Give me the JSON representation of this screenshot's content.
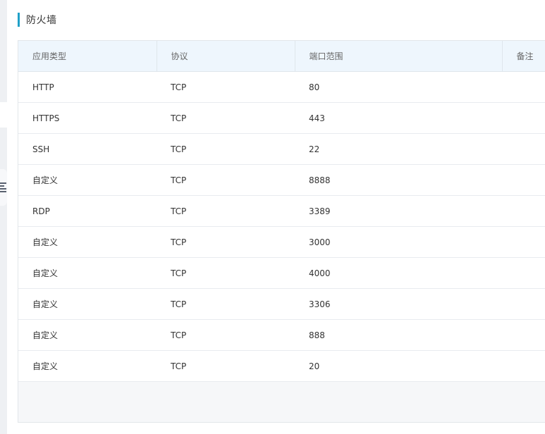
{
  "panel": {
    "title": "防火墙"
  },
  "table": {
    "headers": [
      "应用类型",
      "协议",
      "端口范围",
      "备注"
    ],
    "rows": [
      {
        "app": "HTTP",
        "protocol": "TCP",
        "port": "80",
        "note": ""
      },
      {
        "app": "HTTPS",
        "protocol": "TCP",
        "port": "443",
        "note": ""
      },
      {
        "app": "SSH",
        "protocol": "TCP",
        "port": "22",
        "note": ""
      },
      {
        "app": "自定义",
        "protocol": "TCP",
        "port": "8888",
        "note": ""
      },
      {
        "app": "RDP",
        "protocol": "TCP",
        "port": "3389",
        "note": ""
      },
      {
        "app": "自定义",
        "protocol": "TCP",
        "port": "3000",
        "note": ""
      },
      {
        "app": "自定义",
        "protocol": "TCP",
        "port": "4000",
        "note": ""
      },
      {
        "app": "自定义",
        "protocol": "TCP",
        "port": "3306",
        "note": ""
      },
      {
        "app": "自定义",
        "protocol": "TCP",
        "port": "888",
        "note": ""
      },
      {
        "app": "自定义",
        "protocol": "TCP",
        "port": "20",
        "note": ""
      }
    ]
  },
  "colors": {
    "accent": "#20a0c8",
    "header_bg": "#eef6fd"
  }
}
